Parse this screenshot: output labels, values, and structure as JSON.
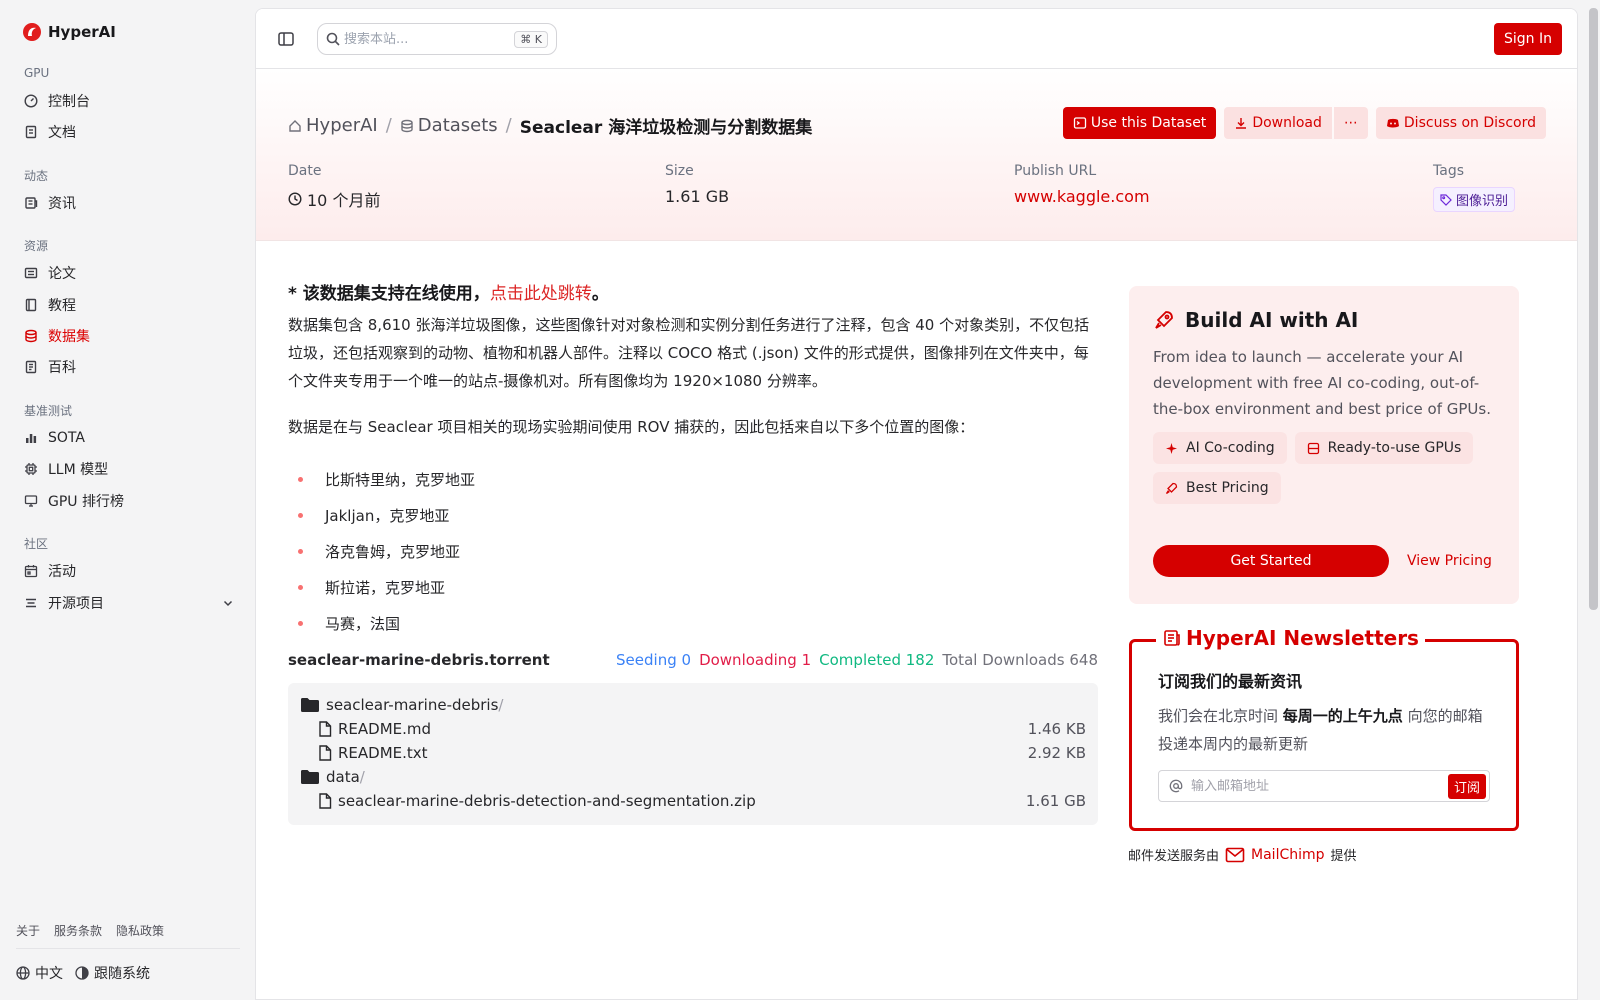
{
  "brand": {
    "name": "HyperAI"
  },
  "sidebar": {
    "sections": [
      {
        "title": "GPU",
        "items": [
          {
            "label": "控制台",
            "icon": "gauge-icon"
          },
          {
            "label": "文档",
            "icon": "doc-icon"
          }
        ]
      },
      {
        "title": "动态",
        "items": [
          {
            "label": "资讯",
            "icon": "news-icon"
          }
        ]
      },
      {
        "title": "资源",
        "items": [
          {
            "label": "论文",
            "icon": "paper-icon"
          },
          {
            "label": "教程",
            "icon": "book-icon"
          },
          {
            "label": "数据集",
            "icon": "database-icon",
            "active": true
          },
          {
            "label": "百科",
            "icon": "wiki-icon"
          }
        ]
      },
      {
        "title": "基准测试",
        "items": [
          {
            "label": "SOTA",
            "icon": "chart-icon"
          },
          {
            "label": "LLM 模型",
            "icon": "chip-icon"
          },
          {
            "label": "GPU 排行榜",
            "icon": "leaderboard-icon"
          }
        ]
      },
      {
        "title": "社区",
        "items": [
          {
            "label": "活动",
            "icon": "event-icon"
          },
          {
            "label": "开源项目",
            "icon": "list-icon"
          }
        ]
      }
    ],
    "footer_links": [
      "关于",
      "服务条款",
      "隐私政策"
    ],
    "language": "中文",
    "theme": "跟随系统"
  },
  "topbar": {
    "search_placeholder": "搜索本站...",
    "shortcut_key": "K",
    "signin": "Sign In"
  },
  "dataset": {
    "breadcrumb": [
      "HyperAI",
      "Datasets"
    ],
    "title": "Seaclear 海洋垃圾检测与分割数据集",
    "actions": {
      "use": "Use this Dataset",
      "download": "Download",
      "more": "⋯",
      "discord": "Discuss on Discord"
    },
    "meta": {
      "date_label": "Date",
      "date_value": "10 个月前",
      "size_label": "Size",
      "size_value": "1.61 GB",
      "url_label": "Publish URL",
      "url_value": "www.kaggle.com",
      "tags_label": "Tags",
      "tag": "图像识别"
    },
    "notice_prefix": "* 该数据集支持在线使用，",
    "notice_link": "点击此处跳转",
    "notice_suffix": "。",
    "description1": "数据集包含 8,610 张海洋垃圾图像，这些图像针对对象检测和实例分割任务进行了注释，包含 40 个对象类别，不仅包括垃圾，还包括观察到的动物、植物和机器人部件。注释以 COCO 格式 (.json) 文件的形式提供，图像排列在文件夹中，每个文件夹专用于一个唯一的站点-摄像机对。所有图像均为 1920×1080 分辨率。",
    "description2": "数据是在与 Seaclear 项目相关的现场实验期间使用 ROV 捕获的，因此包括来自以下多个位置的图像：",
    "locations": [
      "比斯特里纳，克罗地亚",
      "Jakljan，克罗地亚",
      "洛克鲁姆，克罗地亚",
      "斯拉诺，克罗地亚",
      "马赛，法国"
    ],
    "torrent": {
      "name": "seaclear-marine-debris.torrent",
      "seeding_label": "Seeding",
      "seeding": "0",
      "downloading_label": "Downloading",
      "downloading": "1",
      "completed_label": "Completed",
      "completed": "182",
      "total_label": "Total Downloads",
      "total": "648"
    },
    "files": [
      {
        "name": "seaclear-marine-debris",
        "type": "folder",
        "size": "",
        "indent": false
      },
      {
        "name": "README.md",
        "type": "file",
        "size": "1.46 KB",
        "indent": true
      },
      {
        "name": "README.txt",
        "type": "file",
        "size": "2.92 KB",
        "indent": true
      },
      {
        "name": "data",
        "type": "folder",
        "size": "",
        "indent": false
      },
      {
        "name": "seaclear-marine-debris-detection-and-segmentation.zip",
        "type": "file",
        "size": "1.61 GB",
        "indent": true
      }
    ]
  },
  "promo": {
    "title": "Build AI with AI",
    "text": "From idea to launch — accelerate your AI development with free AI co-coding, out-of-the-box environment and best price of GPUs.",
    "chips": [
      "AI Co-coding",
      "Ready-to-use GPUs",
      "Best Pricing"
    ],
    "cta": "Get Started",
    "pricing": "View Pricing"
  },
  "newsletter": {
    "title": "HyperAI Newsletters",
    "heading": "订阅我们的最新资讯",
    "text_prefix": "我们会在北京时间 ",
    "text_bold": "每周一的上午九点",
    "text_suffix": " 向您的邮箱投递本周内的最新更新",
    "email_placeholder": "输入邮箱地址",
    "subscribe": "订阅",
    "provider_prefix": "邮件发送服务由",
    "provider": "MailChimp",
    "provider_suffix": "提供"
  },
  "colors": {
    "accent": "#d50000",
    "seeding": "#3b82f6",
    "downloading": "#e11d48",
    "completed": "#10b981"
  }
}
